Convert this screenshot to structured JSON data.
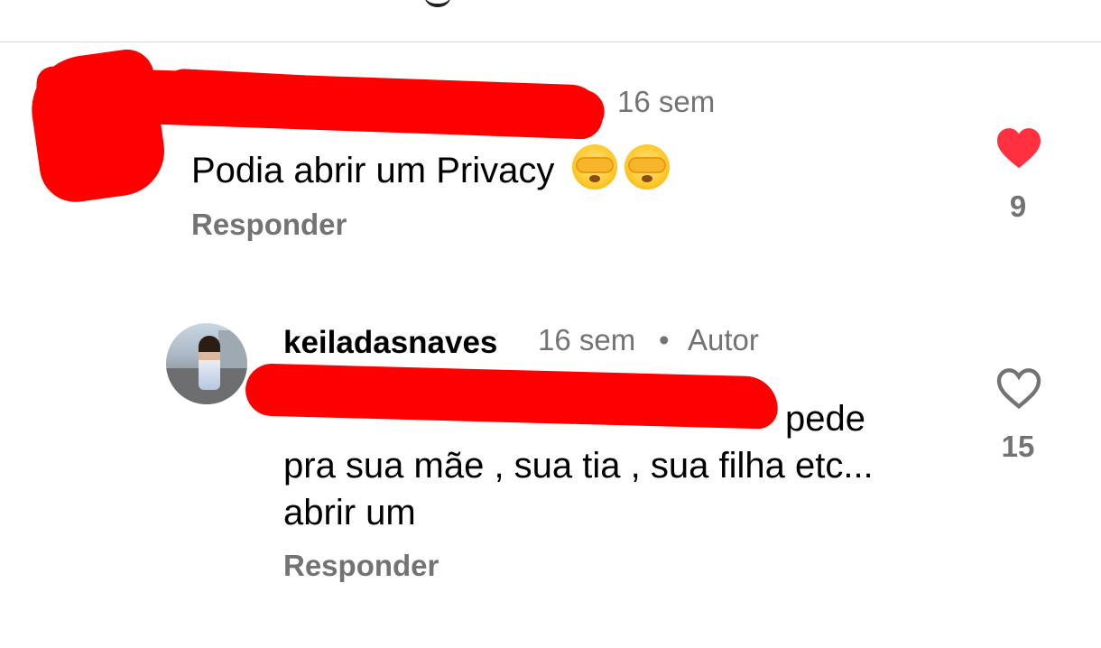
{
  "comments": [
    {
      "author": "",
      "time": "16 sem",
      "text": "Podia abrir um Privacy",
      "emojis": [
        "face-with-hand-over-eyes-icon",
        "face-with-hand-over-eyes-icon"
      ],
      "reply_label": "Responder",
      "likes": "9",
      "liked": true
    },
    {
      "author": "keiladasnaves",
      "time": "16 sem",
      "separator": "•",
      "author_badge": "Autor",
      "text": "pede pra sua mãe , sua tia , sua filha etc... abrir um",
      "reply_label": "Responder",
      "likes": "15",
      "liked": false
    }
  ],
  "colors": {
    "liked_heart": "#ff3040",
    "meta_text": "#737373",
    "mention": "#3b4bd8",
    "redaction": "#fe0000"
  }
}
